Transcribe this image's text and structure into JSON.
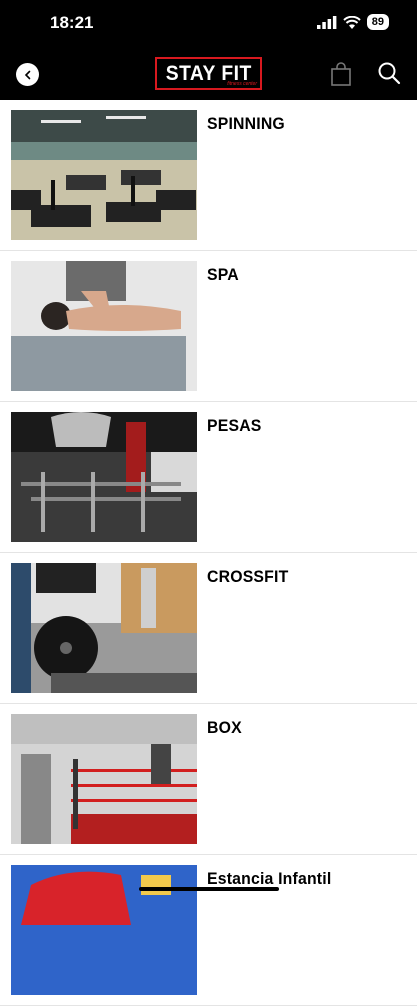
{
  "status_bar": {
    "time": "18:21",
    "battery": "89"
  },
  "header": {
    "logo_text": "STAY FIT",
    "logo_sub": "fitness center"
  },
  "items": [
    {
      "title": "SPINNING"
    },
    {
      "title": "SPA"
    },
    {
      "title": "PESAS"
    },
    {
      "title": "CROSSFIT"
    },
    {
      "title": "BOX"
    },
    {
      "title": "Estancia Infantil"
    }
  ]
}
